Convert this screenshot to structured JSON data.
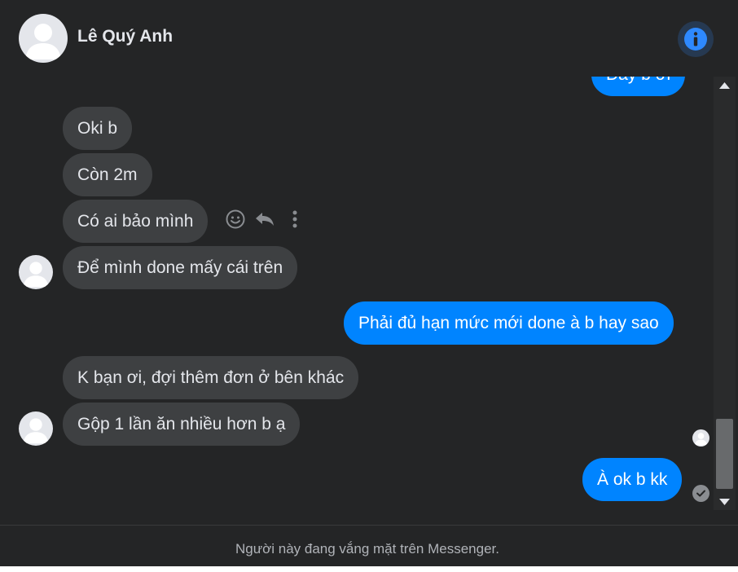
{
  "conversation": {
    "contact_name": "Lê Quý Anh",
    "info_icon": "info-icon"
  },
  "messages": [
    {
      "side": "out",
      "text": "Đây b ơi"
    },
    {
      "side": "in",
      "text": "Oki b"
    },
    {
      "side": "in",
      "text": "Còn 2m"
    },
    {
      "side": "in",
      "text": "Có ai bảo mình"
    },
    {
      "side": "in",
      "text": "Để mình done mấy cái trên"
    },
    {
      "side": "out",
      "text": "Phải đủ hạn mức mới done à b hay sao"
    },
    {
      "side": "in",
      "text": "K bạn ơi, đợi thêm đơn ở bên khác"
    },
    {
      "side": "in",
      "text": "Gộp 1 lần ăn nhiều hơn b ạ"
    },
    {
      "side": "out",
      "text": "À ok b kk"
    }
  ],
  "message_actions": [
    "react-icon",
    "reply-icon",
    "more-options-icon"
  ],
  "footer": {
    "status_text": "Người này đang vắng mặt trên Messenger."
  },
  "colors": {
    "background": "#242526",
    "incoming_bubble": "#3e4042",
    "outgoing_bubble": "#0084ff",
    "accent": "#2e89ff"
  }
}
